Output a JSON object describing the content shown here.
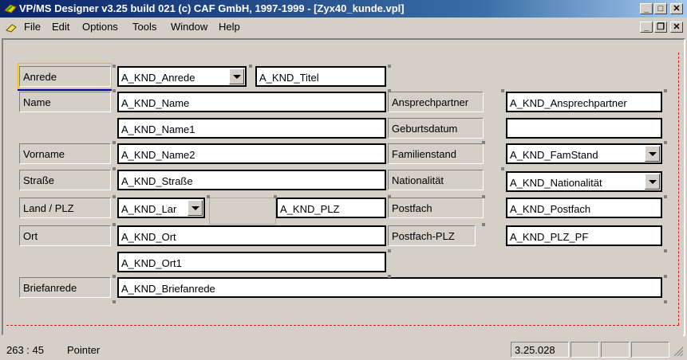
{
  "window": {
    "title": "VP/MS Designer v3.25 build 021 (c) CAF GmbH, 1997-1999 - [Zyx40_kunde.vpl]",
    "min_glyph": "_",
    "max_glyph": "□",
    "close_glyph": "✕"
  },
  "menu": {
    "items": [
      "File",
      "Edit",
      "Options",
      "Tools",
      "Window",
      "Help"
    ],
    "mdi_min": "_",
    "mdi_restore": "❐",
    "mdi_close": "✕"
  },
  "form": {
    "labels": {
      "anrede": "Anrede",
      "name": "Name",
      "vorname": "Vorname",
      "strasse": "Straße",
      "land_plz": "Land / PLZ",
      "ort": "Ort",
      "briefanrede": "Briefanrede",
      "ansprechpartner": "Ansprechpartner",
      "geburtsdatum": "Geburtsdatum",
      "familienstand": "Familienstand",
      "nationalitaet": "Nationalität",
      "postfach": "Postfach",
      "postfach_plz": "Postfach-PLZ"
    },
    "fields": {
      "anrede": "A_KND_Anrede",
      "titel": "A_KND_Titel",
      "name": "A_KND_Name",
      "name1": "A_KND_Name1",
      "name2": "A_KND_Name2",
      "strasse": "A_KND_Straße",
      "land": "A_KND_Lar",
      "plz": "A_KND_PLZ",
      "ort": "A_KND_Ort",
      "ort1": "A_KND_Ort1",
      "briefanrede": "A_KND_Briefanrede",
      "ansprechpartner": "A_KND_Ansprechpartner",
      "geburtsdatum": "",
      "famstand": "A_KND_FamStand",
      "nationalitaet": "A_KND_Nationalität",
      "postfach": "A_KND_Postfach",
      "plz_pf": "A_KND_PLZ_PF"
    }
  },
  "status": {
    "coords": "263 : 45",
    "mode": "Pointer",
    "version": "3.25.028"
  },
  "colors": {
    "titlebar_start": "#0a246a",
    "titlebar_end": "#a6caf0",
    "face": "#d4d0c8",
    "selection": "#e0c000",
    "guide": "#d02020"
  }
}
